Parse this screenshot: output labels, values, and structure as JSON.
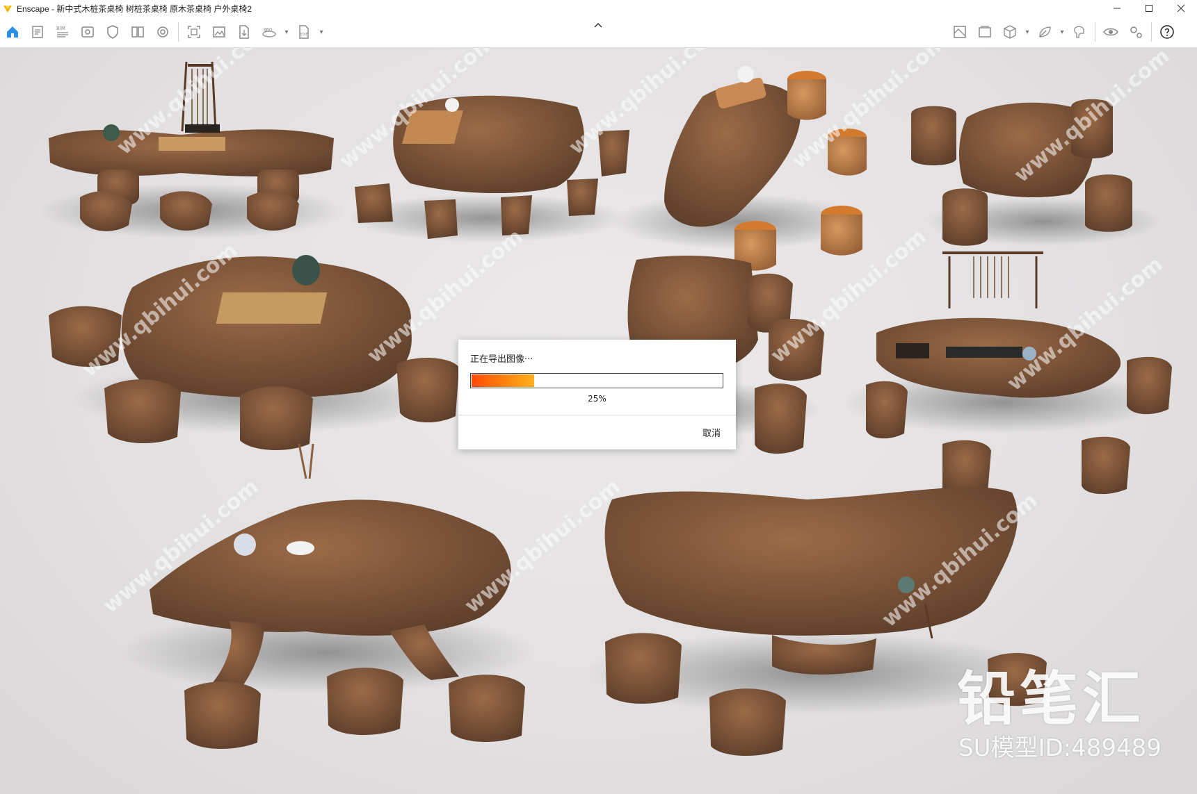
{
  "window": {
    "title": "Enscape - 新中式木桩茶桌椅 树桩茶桌椅 原木茶桌椅 户外桌椅2",
    "controls": [
      "minimize",
      "maximize",
      "close"
    ]
  },
  "toolbar": {
    "bim_label": "BIM",
    "pano_label": "360",
    "exe_label": "EXE",
    "left_tools": [
      "home-icon",
      "document-icon",
      "bim-icon",
      "visual-settings-icon",
      "shield-icon",
      "book-icon",
      "materials-icon",
      "screenshot-icon",
      "image-icon",
      "file-export-icon",
      "panorama-icon",
      "exe-export-icon"
    ],
    "right_tools": [
      "map-icon",
      "gallery-icon",
      "cube-icon",
      "leaf-icon",
      "vr-headset-icon",
      "eye-icon",
      "settings-icon",
      "help-icon"
    ]
  },
  "dialog": {
    "title": "正在导出图像···",
    "progress_percent": 25,
    "progress_label": "25%",
    "cancel_label": "取消"
  },
  "watermark": {
    "brand": "铅笔汇",
    "model_id": "SU模型ID:489489",
    "tile_text": "www.qbihui.com"
  },
  "colors": {
    "accent": "#ff6a0b",
    "home_icon": "#2b8fe6",
    "wood_dark": "#6b4a33",
    "wood_mid": "#8a5f40",
    "wood_light": "#b07a4e"
  }
}
